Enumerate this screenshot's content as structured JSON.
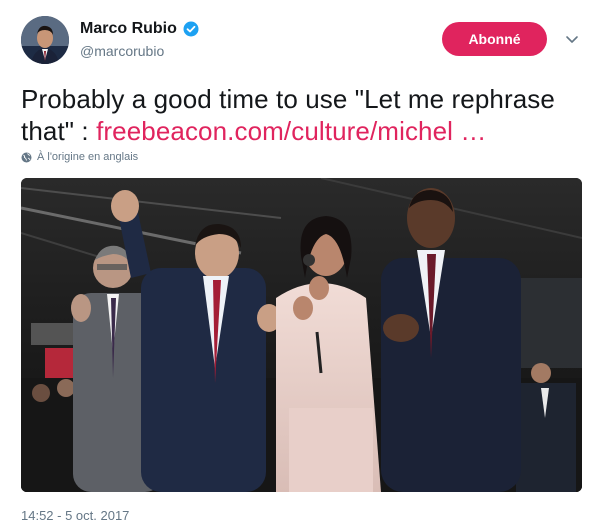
{
  "author": {
    "display_name": "Marco Rubio",
    "handle": "@marcorubio",
    "verified": true
  },
  "follow_button": {
    "label": "Abonné"
  },
  "menu": {
    "icon": "chevron-down-icon"
  },
  "tweet": {
    "text": "Probably a good time to use \"Let me rephrase that\" : ",
    "link_text": "freebeacon.com/culture/michel …"
  },
  "translation_note": {
    "icon": "globe-icon",
    "label": "À l'origine en anglais"
  },
  "timestamp": "14:52 - 5 oct. 2017",
  "colors": {
    "accent": "#e0245e",
    "verified": "#1da1f2",
    "secondary_text": "#657786",
    "primary_text": "#14171a"
  }
}
